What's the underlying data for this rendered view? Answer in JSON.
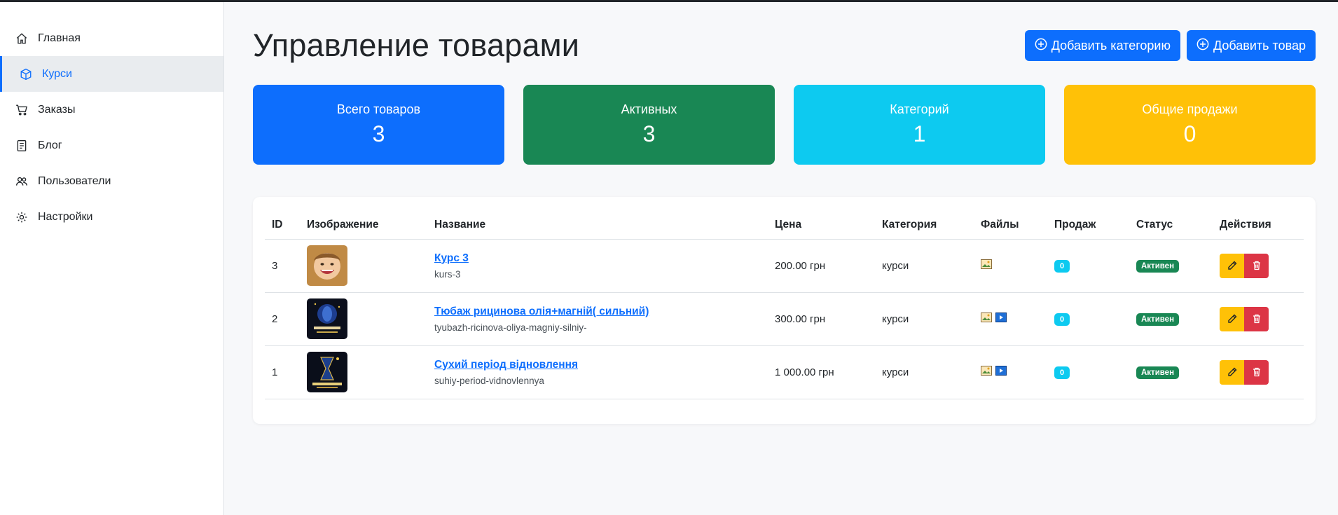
{
  "sidebar": {
    "items": [
      {
        "label": "Главная",
        "icon": "home-icon"
      },
      {
        "label": "Курси",
        "icon": "box-icon",
        "active": true
      },
      {
        "label": "Заказы",
        "icon": "cart-icon"
      },
      {
        "label": "Блог",
        "icon": "document-icon"
      },
      {
        "label": "Пользователи",
        "icon": "users-icon"
      },
      {
        "label": "Настройки",
        "icon": "gear-icon"
      }
    ]
  },
  "header": {
    "title": "Управление товарами",
    "add_category_label": "Добавить категорию",
    "add_product_label": "Добавить товар"
  },
  "stats": [
    {
      "label": "Всего товаров",
      "value": "3",
      "color": "#0d6efd"
    },
    {
      "label": "Активных",
      "value": "3",
      "color": "#198754"
    },
    {
      "label": "Категорий",
      "value": "1",
      "color": "#0dcaf0"
    },
    {
      "label": "Общие продажи",
      "value": "0",
      "color": "#ffc107"
    }
  ],
  "table": {
    "columns": [
      "ID",
      "Изображение",
      "Название",
      "Цена",
      "Категория",
      "Файлы",
      "Продаж",
      "Статус",
      "Действия"
    ],
    "rows": [
      {
        "id": "3",
        "name": "Курс 3",
        "slug": "kurs-3",
        "price": "200.00 грн",
        "category": "курси",
        "files": [
          "image-file-icon"
        ],
        "sales": "0",
        "status": "Активен"
      },
      {
        "id": "2",
        "name": "Тюбаж рицинова олія+магній( сильний)",
        "slug": "tyubazh-ricinova-oliya-magniy-silniy-",
        "price": "300.00 грн",
        "category": "курси",
        "files": [
          "image-file-icon",
          "video-file-icon"
        ],
        "sales": "0",
        "status": "Активен"
      },
      {
        "id": "1",
        "name": "Сухий період відновлення",
        "slug": "suhiy-period-vidnovlennya",
        "price": "1 000.00 грн",
        "category": "курси",
        "files": [
          "image-file-icon",
          "video-file-icon"
        ],
        "sales": "0",
        "status": "Активен"
      }
    ]
  },
  "colors": {
    "primary": "#0d6efd",
    "success": "#198754",
    "info": "#0dcaf0",
    "warning": "#ffc107",
    "danger": "#dc3545"
  }
}
